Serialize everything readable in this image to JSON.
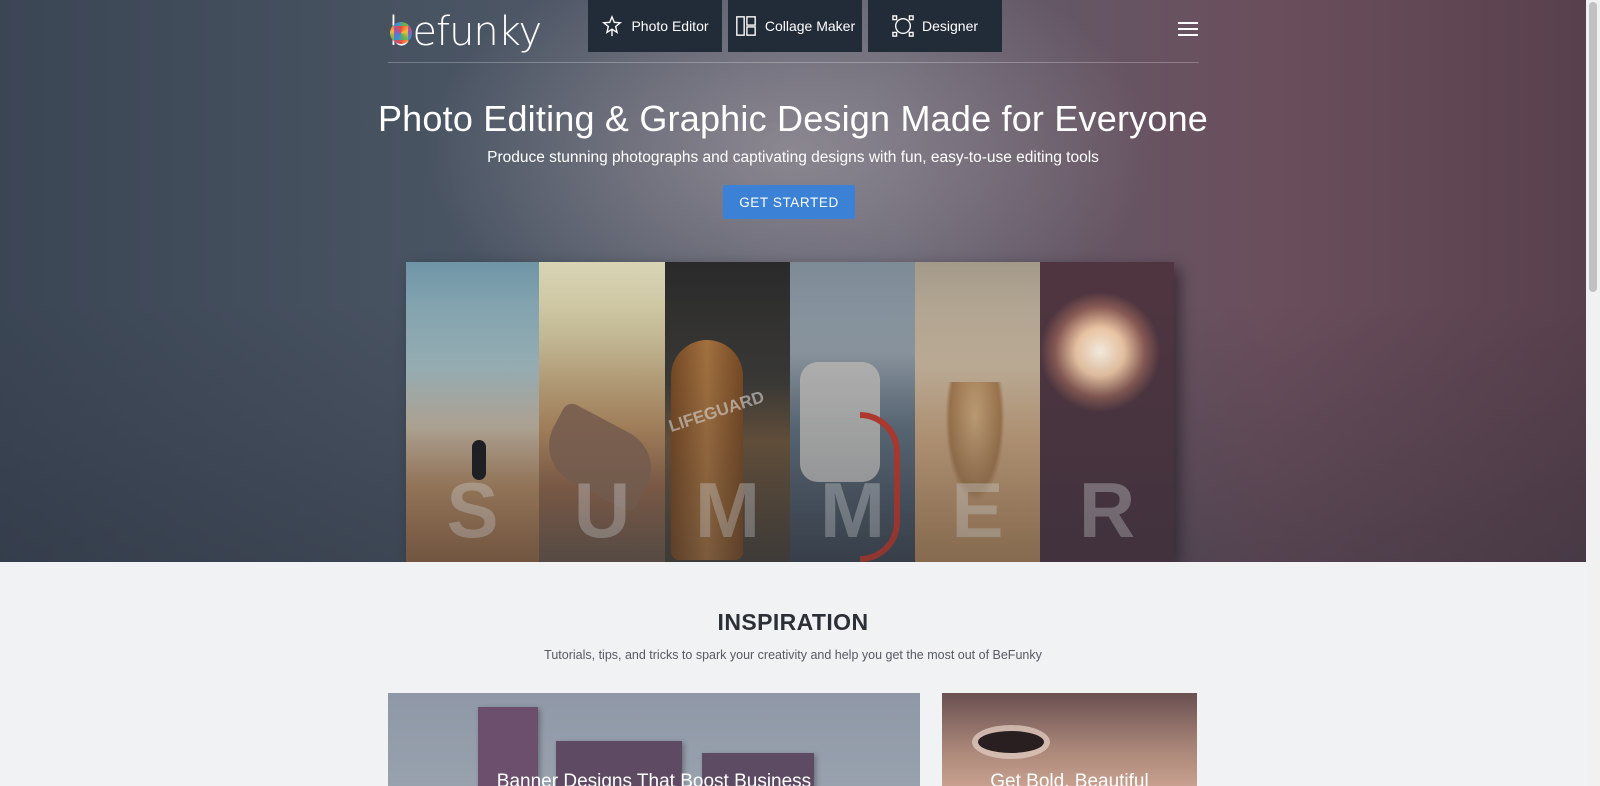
{
  "header": {
    "logo_text": "befunky",
    "nav": [
      {
        "label": "Photo Editor",
        "icon": "star-wand-icon"
      },
      {
        "label": "Collage Maker",
        "icon": "collage-grid-icon"
      },
      {
        "label": "Designer",
        "icon": "designer-circle-icon"
      }
    ],
    "menu_icon": "hamburger-menu-icon"
  },
  "hero": {
    "headline": "Photo Editing & Graphic Design Made for Everyone",
    "subhead": "Produce stunning photographs and captivating designs with fun, easy-to-use editing tools",
    "cta_label": "GET STARTED",
    "collage_letters": [
      "S",
      "U",
      "M",
      "M",
      "E",
      "R"
    ],
    "surfboard_text": "LIFEGUARD"
  },
  "inspiration": {
    "title": "INSPIRATION",
    "subtitle": "Tutorials, tips, and tricks to spark your creativity and help you get the most out of BeFunky",
    "cards": [
      {
        "title": "Banner Designs That Boost Business"
      },
      {
        "title": "Get Bold, Beautiful"
      }
    ]
  },
  "colors": {
    "cta": "#3b82d6",
    "nav_tab": "#222b38",
    "page_bg": "#f1f2f4"
  }
}
